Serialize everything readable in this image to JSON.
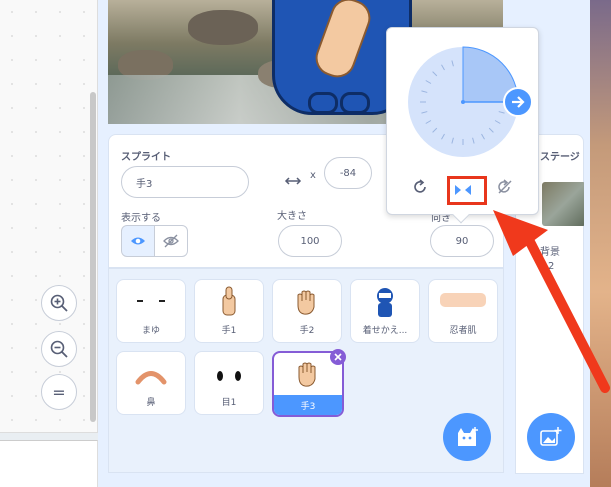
{
  "code_area": {
    "zoom_in_icon": "zoom-in",
    "zoom_out_icon": "zoom-out",
    "zoom_reset_label": "="
  },
  "sprite_info": {
    "sprite_label": "スプライト",
    "sprite_name": "手3",
    "x_label": "x",
    "x_value": "-84",
    "show_label": "表示する",
    "size_label": "大きさ",
    "size_value": "100",
    "direction_label": "向き",
    "direction_value": "90"
  },
  "costumes": [
    {
      "name": "まゆ"
    },
    {
      "name": "手1"
    },
    {
      "name": "手2"
    },
    {
      "name": "着せかえ..."
    },
    {
      "name": "忍者肌"
    },
    {
      "name": "鼻"
    },
    {
      "name": "目1"
    },
    {
      "name": "手3"
    }
  ],
  "stage_panel": {
    "title": "ステージ",
    "backdrops_label": "背景",
    "backdrops_count": "2"
  },
  "direction_popover": {
    "direction_fraction": 0.25
  },
  "colors": {
    "accent": "#4c97ff",
    "highlight": "#e8361c",
    "arrow": "#f0391c"
  }
}
